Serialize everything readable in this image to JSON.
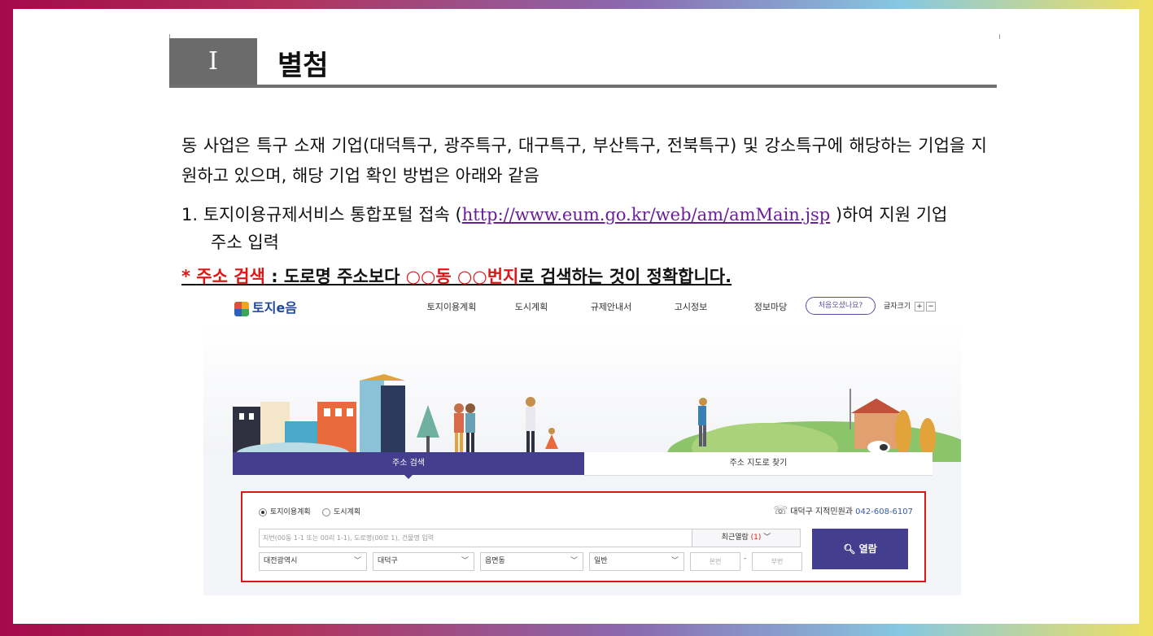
{
  "heading": {
    "number": "Ⅰ",
    "title": "별첨"
  },
  "body": {
    "para1": "동 사업은 특구 소재 기업(대덕특구, 광주특구, 대구특구, 부산특구, 전북특구) 및 강소특구에 해당하는 기업을 지원하고 있으며, 해당 기업 확인 방법은 아래와 같음",
    "step1_prefix": "1. 토지이용규제서비스 통합포털 접속 (",
    "step1_link": "http://www.eum.go.kr/web/am/amMain.jsp",
    "step1_suffix": " )하여 지원 기업",
    "step1_line2": "주소 입력",
    "note_star": "* ",
    "note_red1": "주소 검색",
    "note_mid": " : 도로명 주소보다 ",
    "note_red2": "○○동 ○○번지",
    "note_end": "로 검색하는 것이 정확합니다."
  },
  "site": {
    "logo": "토지e음",
    "nav": [
      "토지이용계획",
      "도시계획",
      "규제안내서",
      "고시정보",
      "정보마당"
    ],
    "first_time": "처음오셨나요?",
    "font_size": "글자크기",
    "fs_plus": "+",
    "fs_minus": "−",
    "tab_active": "주소 검색",
    "tab_other": "주소 지도로 찾기",
    "radio1": "토지이용계획",
    "radio2": "도시계획",
    "phone_label": "대덕구 지적민원과",
    "phone_number": "042-608-6107",
    "search_placeholder": "지번(00동 1-1 또는 00리 1-1), 도로명(00로 1), 건물명 입력",
    "recent_label": "최근열람",
    "recent_count": "(1)",
    "select_city": "대전광역시",
    "select_district": "대덕구",
    "select_town": "읍면동",
    "select_type": "일반",
    "main_no": "본번",
    "sub_no": "부번",
    "dash": "-",
    "open_button": "열람"
  },
  "colors": {
    "accent": "#433f8e",
    "red": "#e01616",
    "link": "#6a1e9a"
  },
  "icons": [
    "search-icon",
    "phone-icon",
    "chevron-down-icon",
    "radio-icon"
  ]
}
